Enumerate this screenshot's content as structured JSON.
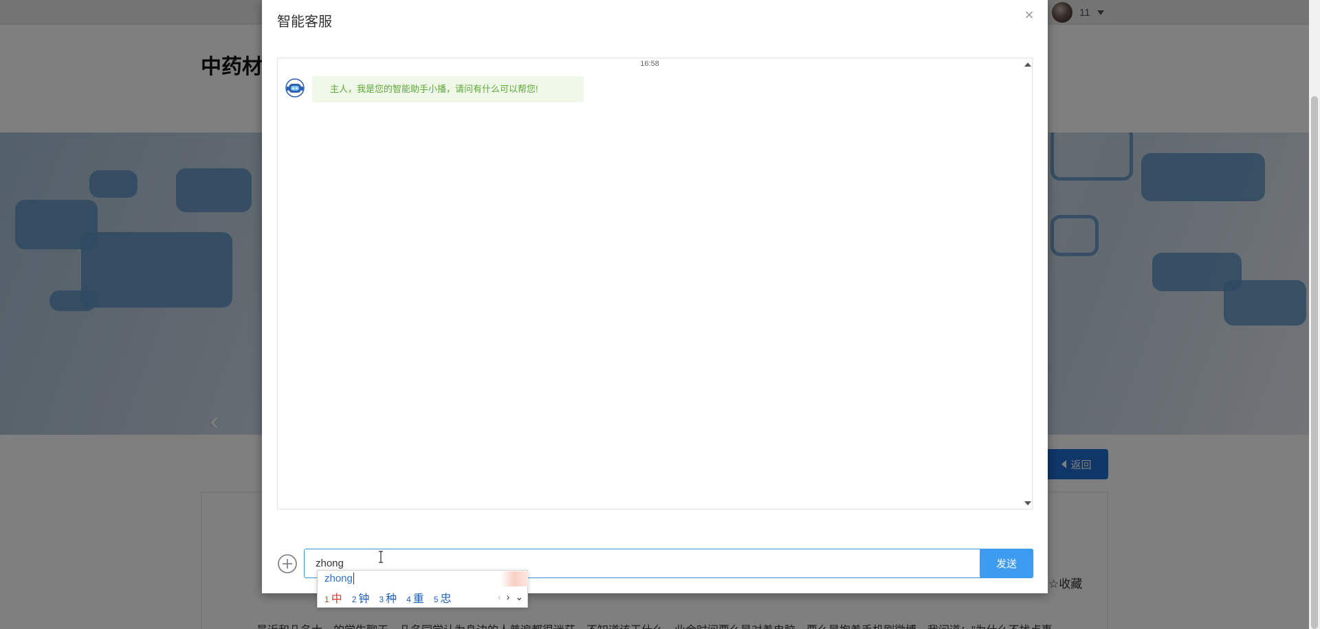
{
  "nav": {
    "user_count": "11"
  },
  "page": {
    "title": "中药材",
    "back_label": "返回",
    "favorite_label": "☆收藏",
    "article_snippet": "最近和几名大一的学生聊天，几名同学认为身边的人普遍都很迷茫，不知道该干什么，业余时间要么是对着电脑，要么是抱着手机刷微博。我问道：\"为什么不找点事"
  },
  "modal": {
    "title": "智能客服",
    "close_symbol": "×"
  },
  "chat": {
    "time": "16:58",
    "messages": [
      {
        "sender": "bot",
        "text": "主人，我是您的智能助手小播，请问有什么可以帮您!"
      }
    ]
  },
  "composer": {
    "input_value": "zhong",
    "send_label": "发送"
  },
  "ime": {
    "composition": "zhong",
    "candidates": [
      {
        "num": "1",
        "text": "中"
      },
      {
        "num": "2",
        "text": "钟"
      },
      {
        "num": "3",
        "text": "种"
      },
      {
        "num": "4",
        "text": "重"
      },
      {
        "num": "5",
        "text": "忠"
      }
    ],
    "prev_symbol": "‹",
    "next_symbol": "›",
    "expand_symbol": "⌄"
  },
  "colors": {
    "accent": "#3d9bf0",
    "back_button": "#1e6fd0",
    "bot_text": "#5fa936",
    "bot_bubble": "#eef7e8",
    "ime_first": "#e2382b"
  },
  "icons": {
    "close": "close-icon",
    "plus": "plus-circle-icon",
    "bot": "robot-avatar-icon",
    "user": "user-avatar",
    "caret": "caret-down-icon",
    "back": "caret-left-icon"
  }
}
